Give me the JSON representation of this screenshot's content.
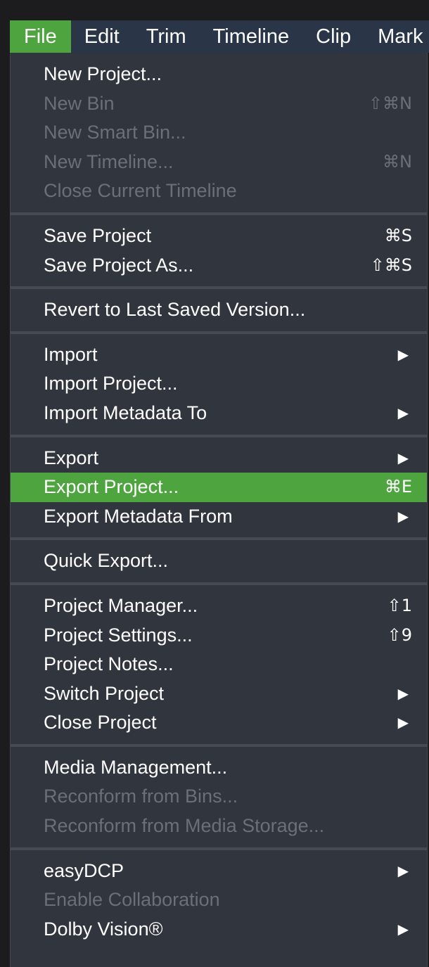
{
  "menubar": {
    "items": [
      "File",
      "Edit",
      "Trim",
      "Timeline",
      "Clip",
      "Mark"
    ]
  },
  "menu": {
    "groups": [
      [
        {
          "label": "New Project...",
          "shortcut": "",
          "submenu": false,
          "disabled": false
        },
        {
          "label": "New Bin",
          "shortcut": "⇧⌘N",
          "submenu": false,
          "disabled": true
        },
        {
          "label": "New Smart Bin...",
          "shortcut": "",
          "submenu": false,
          "disabled": true
        },
        {
          "label": "New Timeline...",
          "shortcut": "⌘N",
          "submenu": false,
          "disabled": true
        },
        {
          "label": "Close Current Timeline",
          "shortcut": "",
          "submenu": false,
          "disabled": true
        }
      ],
      [
        {
          "label": "Save Project",
          "shortcut": "⌘S",
          "submenu": false,
          "disabled": false
        },
        {
          "label": "Save Project As...",
          "shortcut": "⇧⌘S",
          "submenu": false,
          "disabled": false
        }
      ],
      [
        {
          "label": "Revert to Last Saved Version...",
          "shortcut": "",
          "submenu": false,
          "disabled": false
        }
      ],
      [
        {
          "label": "Import",
          "shortcut": "",
          "submenu": true,
          "disabled": false
        },
        {
          "label": "Import Project...",
          "shortcut": "",
          "submenu": false,
          "disabled": false
        },
        {
          "label": "Import Metadata To",
          "shortcut": "",
          "submenu": true,
          "disabled": false
        }
      ],
      [
        {
          "label": "Export",
          "shortcut": "",
          "submenu": true,
          "disabled": false
        },
        {
          "label": "Export Project...",
          "shortcut": "⌘E",
          "submenu": false,
          "disabled": false,
          "highlighted": true
        },
        {
          "label": "Export Metadata From",
          "shortcut": "",
          "submenu": true,
          "disabled": false
        }
      ],
      [
        {
          "label": "Quick Export...",
          "shortcut": "",
          "submenu": false,
          "disabled": false
        }
      ],
      [
        {
          "label": "Project Manager...",
          "shortcut": "⇧1",
          "submenu": false,
          "disabled": false
        },
        {
          "label": "Project Settings...",
          "shortcut": "⇧9",
          "submenu": false,
          "disabled": false
        },
        {
          "label": "Project Notes...",
          "shortcut": "",
          "submenu": false,
          "disabled": false
        },
        {
          "label": "Switch Project",
          "shortcut": "",
          "submenu": true,
          "disabled": false
        },
        {
          "label": "Close Project",
          "shortcut": "",
          "submenu": true,
          "disabled": false
        }
      ],
      [
        {
          "label": "Media Management...",
          "shortcut": "",
          "submenu": false,
          "disabled": false
        },
        {
          "label": "Reconform from Bins...",
          "shortcut": "",
          "submenu": false,
          "disabled": true
        },
        {
          "label": "Reconform from Media Storage...",
          "shortcut": "",
          "submenu": false,
          "disabled": true
        }
      ],
      [
        {
          "label": "easyDCP",
          "shortcut": "",
          "submenu": true,
          "disabled": false
        },
        {
          "label": "Enable Collaboration",
          "shortcut": "",
          "submenu": false,
          "disabled": true
        },
        {
          "label": "Dolby Vision®",
          "shortcut": "",
          "submenu": true,
          "disabled": false
        }
      ]
    ]
  },
  "colors": {
    "highlight": "#4ea43f",
    "menubar_bg": "#2a3547",
    "menu_bg": "#31353d",
    "disabled_text": "#6b6f76"
  }
}
